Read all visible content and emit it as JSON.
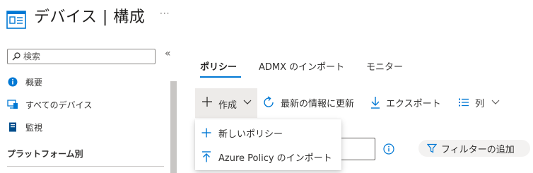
{
  "header": {
    "title": "デバイス | 構成",
    "more_label": "···",
    "icon": "device-config-icon"
  },
  "sidebar": {
    "search_placeholder": "検索",
    "collapse_label": "«",
    "items": [
      {
        "label": "概要",
        "icon": "info-icon"
      },
      {
        "label": "すべてのデバイス",
        "icon": "devices-icon"
      },
      {
        "label": "監視",
        "icon": "monitor-icon"
      }
    ],
    "section_label": "プラットフォーム別"
  },
  "tabs": [
    {
      "label": "ポリシー",
      "active": true
    },
    {
      "label": "ADMX のインポート",
      "active": false
    },
    {
      "label": "モニター",
      "active": false
    }
  ],
  "toolbar": {
    "create_label": "作成",
    "refresh_label": "最新の情報に更新",
    "export_label": "エクスポート",
    "columns_label": "列"
  },
  "dropdown": {
    "items": [
      {
        "label": "新しいポリシー",
        "icon": "plus-icon"
      },
      {
        "label": "Azure Policy のインポート",
        "icon": "upload-icon"
      }
    ]
  },
  "filter": {
    "add_filter_label": "フィルターの追加"
  },
  "colors": {
    "accent": "#0078d4",
    "button_pressed_bg": "#edebe9",
    "text": "#323130"
  }
}
